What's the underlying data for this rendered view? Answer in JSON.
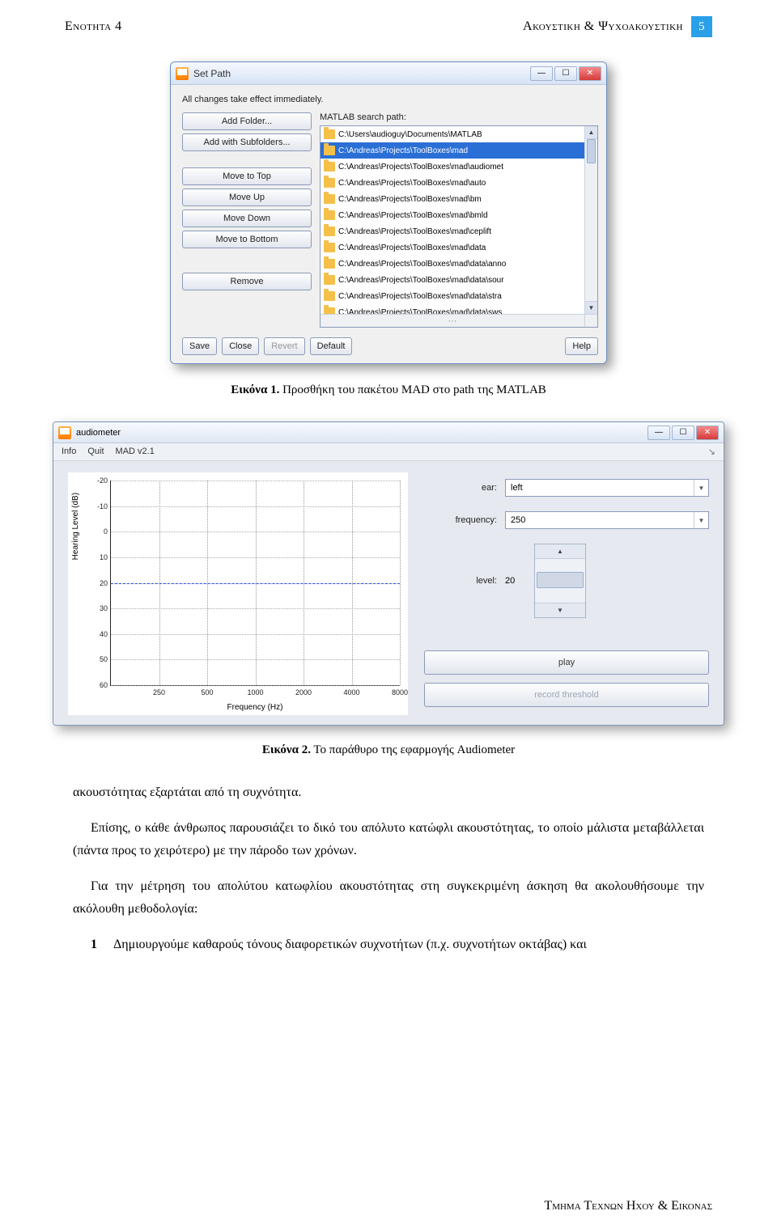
{
  "header": {
    "left": "Ενοτητα 4",
    "right": "Ακουστικη & Ψυχοακουστικη",
    "page": "5"
  },
  "setpath": {
    "title": "Set Path",
    "notice": "All changes take effect immediately.",
    "label": "MATLAB search path:",
    "buttons": {
      "add_folder": "Add Folder...",
      "add_subfolders": "Add with Subfolders...",
      "move_top": "Move to Top",
      "move_up": "Move Up",
      "move_down": "Move Down",
      "move_bottom": "Move to Bottom",
      "remove": "Remove",
      "save": "Save",
      "close": "Close",
      "revert": "Revert",
      "default": "Default",
      "help": "Help"
    },
    "items": [
      "C:\\Users\\audioguy\\Documents\\MATLAB",
      "C:\\Andreas\\Projects\\ToolBoxes\\mad",
      "C:\\Andreas\\Projects\\ToolBoxes\\mad\\audiomet",
      "C:\\Andreas\\Projects\\ToolBoxes\\mad\\auto",
      "C:\\Andreas\\Projects\\ToolBoxes\\mad\\bm",
      "C:\\Andreas\\Projects\\ToolBoxes\\mad\\bmld",
      "C:\\Andreas\\Projects\\ToolBoxes\\mad\\ceplift",
      "C:\\Andreas\\Projects\\ToolBoxes\\mad\\data",
      "C:\\Andreas\\Projects\\ToolBoxes\\mad\\data\\anno",
      "C:\\Andreas\\Projects\\ToolBoxes\\mad\\data\\sour",
      "C:\\Andreas\\Projects\\ToolBoxes\\mad\\data\\stra",
      "C:\\Andreas\\Projects\\ToolBoxes\\mad\\data\\sws"
    ],
    "selected_index": 1
  },
  "caption1": {
    "label": "Εικόνα 1.",
    "text": " Προσθήκη του πακέτου MAD στο path της MATLAB"
  },
  "aud": {
    "title": "audiometer",
    "menu": {
      "info": "Info",
      "quit": "Quit",
      "ver": "MAD v2.1"
    },
    "controls": {
      "ear_label": "ear:",
      "ear_value": "left",
      "freq_label": "frequency:",
      "freq_value": "250",
      "level_label": "level:",
      "level_value": "20",
      "play": "play",
      "record": "record threshold"
    },
    "chart": {
      "ylabel": "Hearing Level (dB)",
      "xlabel": "Frequency (Hz)",
      "yticks": [
        "-20",
        "-10",
        "0",
        "10",
        "20",
        "30",
        "40",
        "50",
        "60"
      ],
      "xticks": [
        "250",
        "500",
        "1000",
        "2000",
        "4000",
        "8000"
      ]
    }
  },
  "chart_data": {
    "type": "line",
    "title": "",
    "xlabel": "Frequency (Hz)",
    "ylabel": "Hearing Level (dB)",
    "x": [
      250,
      500,
      1000,
      2000,
      4000,
      8000
    ],
    "y": [
      20,
      20,
      20,
      20,
      20,
      20
    ],
    "xlim": [
      125,
      8000
    ],
    "ylim": [
      -20,
      60
    ],
    "x_scale": "log",
    "annotations": [
      "current level indicator at 20 dB"
    ]
  },
  "caption2": {
    "label": "Εικόνα 2.",
    "text": " Το παράθυρο της εφαρμογής Audiometer"
  },
  "body": {
    "p1": "ακουστότητας εξαρτάται από τη συχνότητα.",
    "p2": "Επίσης, ο κάθε άνθρωπος παρουσιάζει το δικό του απόλυτο κατώφλι ακουστότητας, το οποίο μάλιστα μεταβάλλεται (πάντα προς το χειρότερο) με την πάροδο των χρόνων.",
    "p3": "Για την μέτρηση του απολύτου κατωφλίου ακουστότητας στη συγκεκριμένη άσκηση θα ακολουθήσουμε την ακόλουθη μεθοδολογία:",
    "list1_num": "1",
    "list1_text": "Δημιουργούμε καθαρούς τόνους διαφορετικών συχνοτήτων (π.χ. συχνοτήτων οκτάβας) και"
  },
  "footer": "Τμημα Τεχνων Ηχου & Εικονας"
}
